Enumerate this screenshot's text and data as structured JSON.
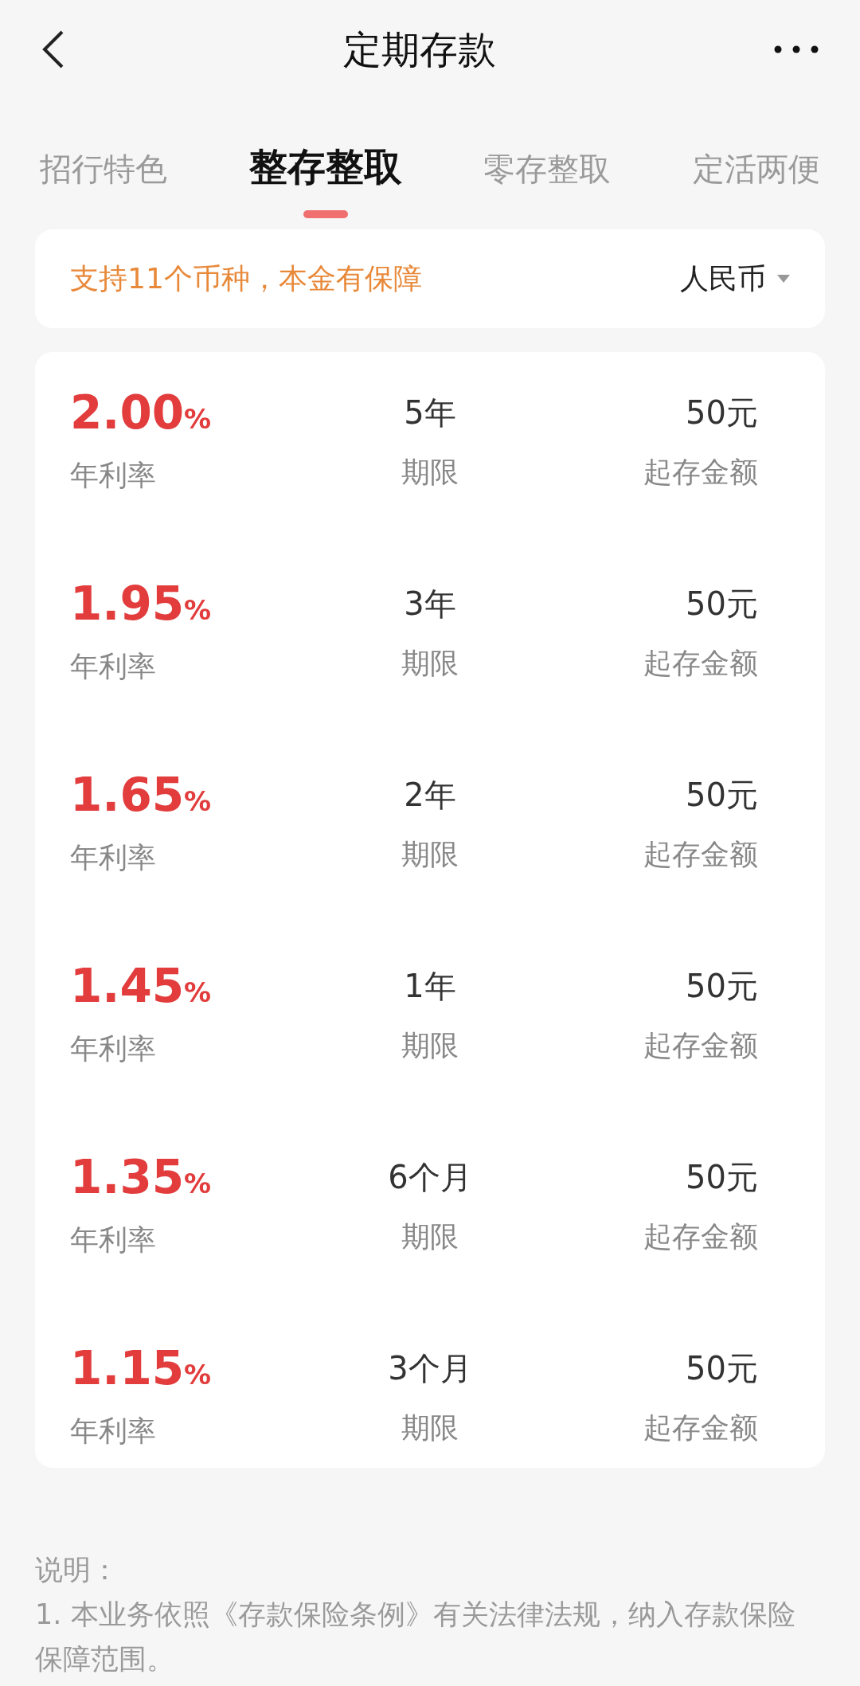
{
  "header": {
    "title": "定期存款"
  },
  "tabs": [
    {
      "label": "招行特色",
      "selected": false
    },
    {
      "label": "整存整取",
      "selected": true
    },
    {
      "label": "零存整取",
      "selected": false
    },
    {
      "label": "定活两便",
      "selected": false
    }
  ],
  "notice": {
    "text": "支持11个币种，本金有保障",
    "currency": "人民币"
  },
  "products": [
    {
      "rate": "2.00",
      "unit": "%",
      "rate_label": "年利率",
      "term": "5年",
      "term_label": "期限",
      "amount": "50元",
      "amount_label": "起存金额"
    },
    {
      "rate": "1.95",
      "unit": "%",
      "rate_label": "年利率",
      "term": "3年",
      "term_label": "期限",
      "amount": "50元",
      "amount_label": "起存金额"
    },
    {
      "rate": "1.65",
      "unit": "%",
      "rate_label": "年利率",
      "term": "2年",
      "term_label": "期限",
      "amount": "50元",
      "amount_label": "起存金额"
    },
    {
      "rate": "1.45",
      "unit": "%",
      "rate_label": "年利率",
      "term": "1年",
      "term_label": "期限",
      "amount": "50元",
      "amount_label": "起存金额"
    },
    {
      "rate": "1.35",
      "unit": "%",
      "rate_label": "年利率",
      "term": "6个月",
      "term_label": "期限",
      "amount": "50元",
      "amount_label": "起存金额"
    },
    {
      "rate": "1.15",
      "unit": "%",
      "rate_label": "年利率",
      "term": "3个月",
      "term_label": "期限",
      "amount": "50元",
      "amount_label": "起存金额"
    }
  ],
  "notes": {
    "title": "说明：",
    "items": [
      "1. 本业务依照《存款保险条例》有关法律法规，纳入存款保险保障范围。"
    ]
  }
}
